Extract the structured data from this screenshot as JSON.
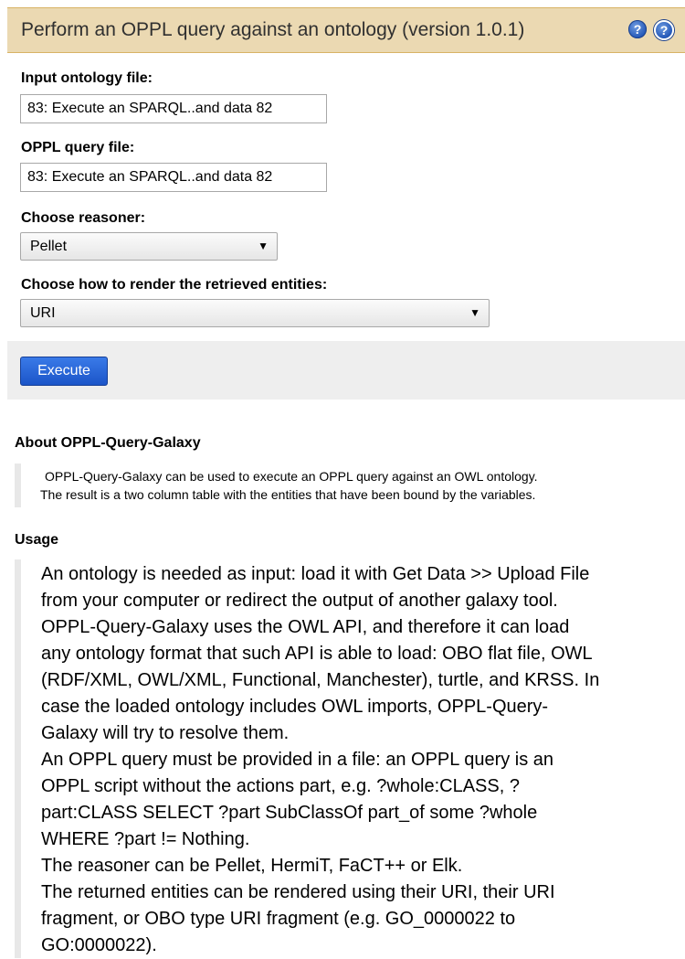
{
  "header": {
    "title": "Perform an OPPL query against an ontology (version 1.0.1)",
    "help_icon_1": "?",
    "help_icon_2": "?"
  },
  "form": {
    "input_ontology": {
      "label": "Input ontology file:",
      "value": "83: Execute an SPARQL..and data 82"
    },
    "oppl_query": {
      "label": "OPPL query file:",
      "value": "83: Execute an SPARQL..and data 82"
    },
    "reasoner": {
      "label": "Choose reasoner:",
      "selected": "Pellet"
    },
    "render": {
      "label": "Choose how to render the retrieved entities:",
      "selected": "URI"
    },
    "execute_label": "Execute"
  },
  "about": {
    "heading": "About OPPL-Query-Galaxy",
    "lines": [
      "OPPL-Query-Galaxy can be used to execute an OPPL query against an OWL ontology.",
      "The result is a two column table with the entities that have been bound by the variables."
    ]
  },
  "usage": {
    "heading": "Usage",
    "lines": [
      "An ontology is needed as input: load it with Get Data >> Upload File",
      "from your computer or redirect the output of another galaxy tool.",
      "OPPL-Query-Galaxy uses the OWL API, and therefore it can load",
      "any ontology format that such API is able to load: OBO flat file, OWL",
      "(RDF/XML, OWL/XML, Functional, Manchester), turtle, and KRSS. In",
      "case the loaded ontology includes OWL imports, OPPL-Query-",
      "Galaxy will try to resolve them.",
      "An OPPL query must be provided in a file: an OPPL query is an",
      "OPPL script without the actions part, e.g. ?whole:CLASS, ?",
      "part:CLASS SELECT ?part SubClassOf part_of some ?whole",
      "WHERE ?part != Nothing.",
      "The reasoner can be Pellet, HermiT, FaCT++ or Elk.",
      "The returned entities can be rendered using their URI, their URI",
      "fragment, or OBO type URI fragment (e.g. GO_0000022 to",
      "GO:0000022)."
    ]
  }
}
